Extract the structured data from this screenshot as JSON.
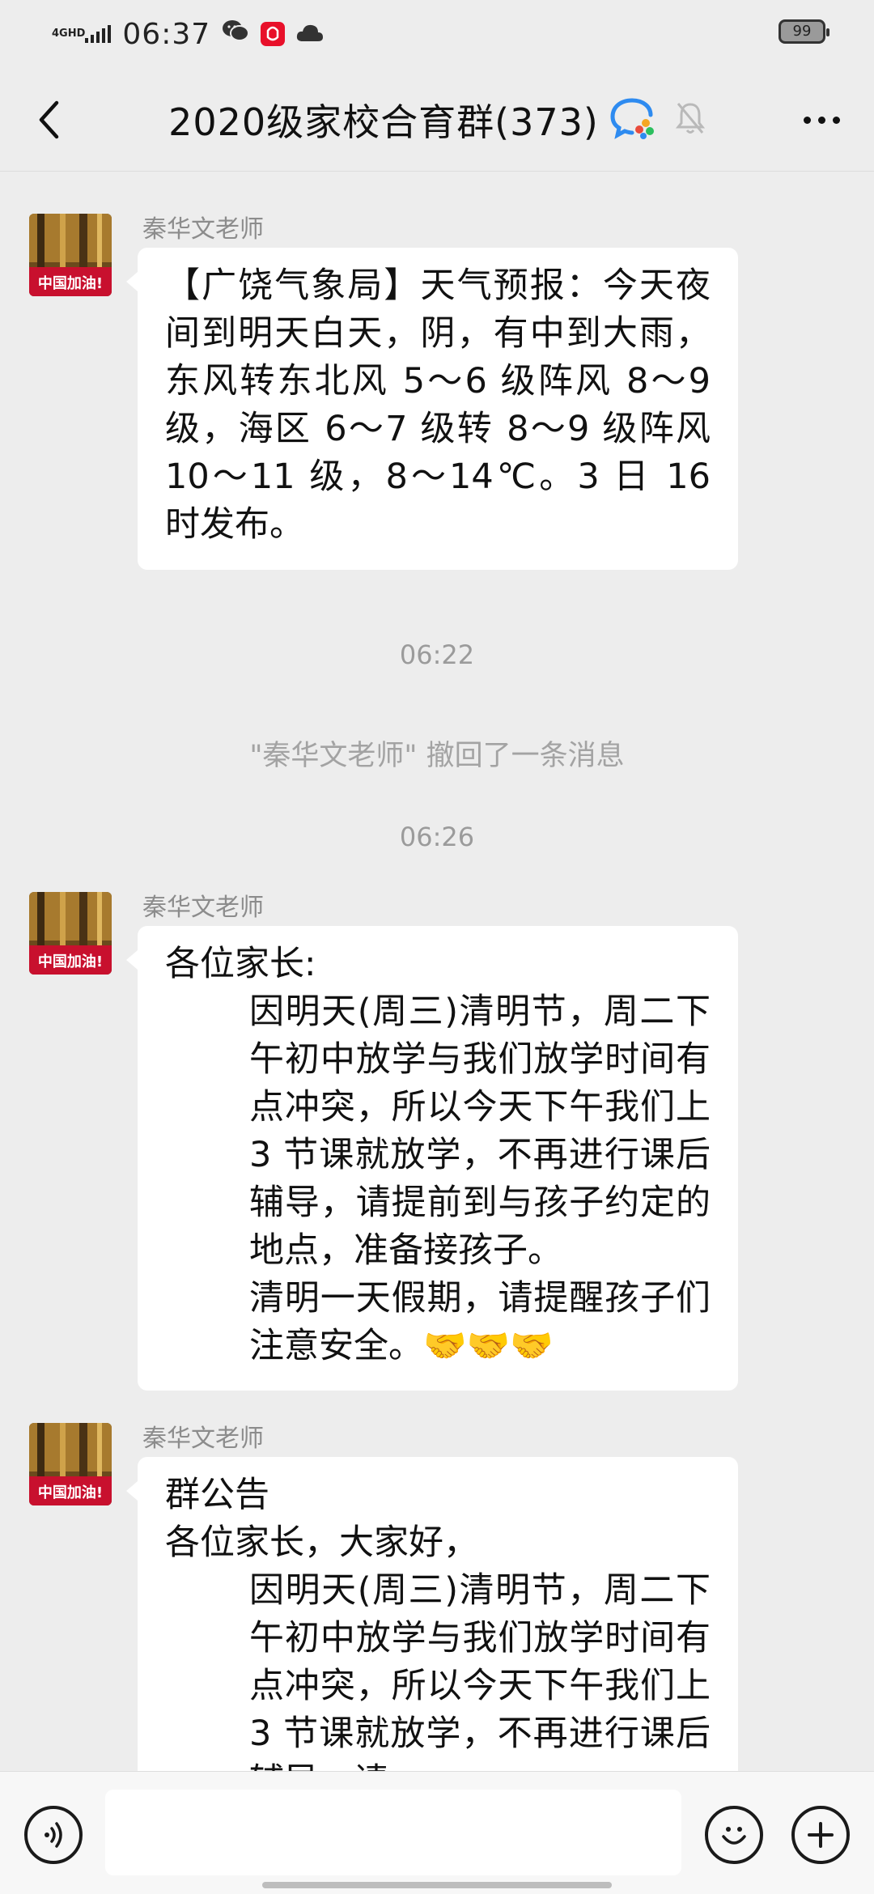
{
  "status_bar": {
    "network": "4GHD",
    "time": "06:37",
    "battery": "99"
  },
  "header": {
    "title": "2020级家校合育群(373)"
  },
  "messages": [
    {
      "sender": "秦华文老师",
      "avatar_text": "中国加油!",
      "paragraphs": [
        "【广饶气象局】天气预报：今天夜间到明天白天，阴，有中到大雨，东风转东北风 5～6 级阵风 8～9 级，海区 6～7 级转 8～9 级阵风 10～11 级，8～14℃。3 日 16 时发布。"
      ]
    },
    {
      "sender": "秦华文老师",
      "avatar_text": "中国加油!",
      "paragraphs": [
        "各位家长:",
        "因明天(周三)清明节，周二下午初中放学与我们放学时间有点冲突，所以今天下午我们上 3 节课就放学，不再进行课后辅导，请提前到与孩子约定的地点，准备接孩子。",
        "清明一天假期，请提醒孩子们注意安全。🤝🤝🤝"
      ]
    },
    {
      "sender": "秦华文老师",
      "avatar_text": "中国加油!",
      "paragraphs": [
        "群公告",
        "各位家长，大家好，",
        "因明天(周三)清明节，周二下午初中放学与我们放学时间有点冲突，所以今天下午我们上 3 节课就放学，不再进行课后辅导，请"
      ]
    }
  ],
  "timestamps": [
    "06:22",
    "06:26"
  ],
  "system_message": "\"秦华文老师\" 撤回了一条消息",
  "colors": {
    "background": "#ededed",
    "bubble": "#ffffff",
    "avatar_banner": "#c8102e"
  }
}
